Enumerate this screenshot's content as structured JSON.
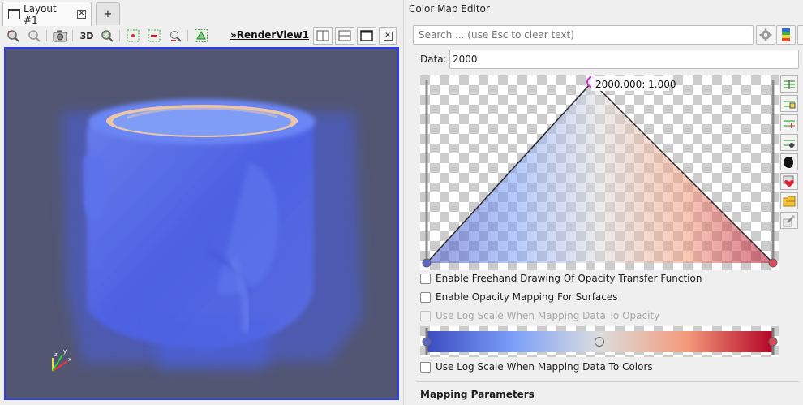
{
  "layout": {
    "tab_label": "Layout #1",
    "add_tab_label": "+",
    "toolbar": {
      "three_d_label": "3D",
      "render_view_prefix": "»",
      "render_view_name": "RenderView1"
    }
  },
  "render_view": {
    "background_color": "#525673",
    "border_color": "#2b3ff0",
    "axes": {
      "x": "x",
      "y": "y",
      "z": "z"
    }
  },
  "color_map_editor": {
    "title": "Color Map Editor",
    "search_placeholder": "Search ... (use Esc to clear text)",
    "data_label": "Data:",
    "data_value": "2000",
    "opacity_point_tooltip": "2000.000: 1.000",
    "opacity_function": [
      {
        "x": 0.0,
        "opacity": 0.0
      },
      {
        "x": 0.487,
        "opacity": 1.0
      },
      {
        "x": 1.0,
        "opacity": 0.0
      }
    ],
    "colormap_stops": [
      {
        "pos": 0.0,
        "color": "#3b4cc0"
      },
      {
        "pos": 0.5,
        "color": "#dddddd"
      },
      {
        "pos": 1.0,
        "color": "#b40426"
      }
    ],
    "options": {
      "freehand": "Enable Freehand Drawing Of Opacity Transfer Function",
      "opacity_surfaces": "Enable Opacity Mapping For Surfaces",
      "log_opacity": "Use Log Scale When Mapping Data To Opacity",
      "log_colors": "Use Log Scale When Mapping Data To Colors"
    },
    "next_section": "Mapping Parameters"
  }
}
